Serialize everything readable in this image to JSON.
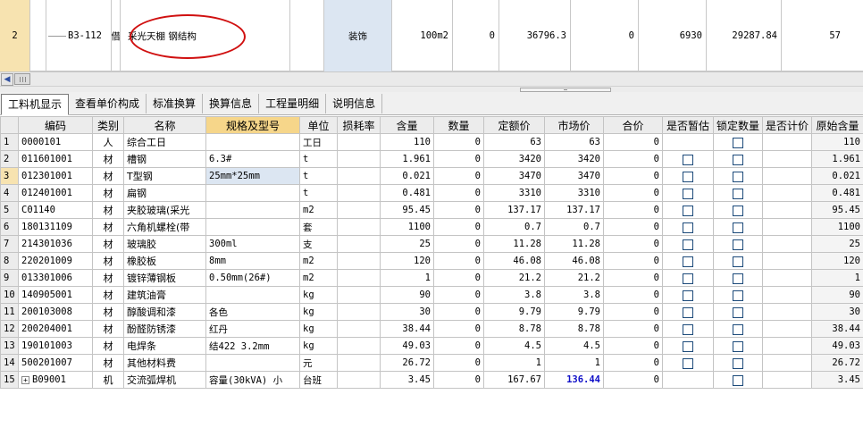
{
  "quota_row": {
    "row_no": "2",
    "code": "B3-112",
    "type": "借",
    "name": "采光天棚 钢结构",
    "major": "装饰",
    "unit": "100m2",
    "quantity": "0",
    "price1": "36796.3",
    "price2": "0",
    "price3": "6930",
    "price4": "29287.84",
    "price5": "57"
  },
  "tabs": [
    {
      "label": "工料机显示",
      "active": true
    },
    {
      "label": "查看单价构成"
    },
    {
      "label": "标准换算"
    },
    {
      "label": "换算信息"
    },
    {
      "label": "工程量明细"
    },
    {
      "label": "说明信息"
    }
  ],
  "columns": [
    "编码",
    "类别",
    "名称",
    "规格及型号",
    "单位",
    "损耗率",
    "含量",
    "数量",
    "定额价",
    "市场价",
    "合价",
    "是否暂估",
    "锁定数量",
    "是否计价",
    "原始含量"
  ],
  "rows": [
    {
      "no": "1",
      "code": "0000101",
      "cat": "人",
      "name": "综合工日",
      "spec": "",
      "unit": "工日",
      "loss": "",
      "content": "110",
      "qty": "0",
      "base": "63",
      "market": "63",
      "total": "0",
      "est": false,
      "lock": true,
      "orig": "110"
    },
    {
      "no": "2",
      "code": "011601001",
      "cat": "材",
      "name": "槽钢",
      "spec": "6.3#",
      "unit": "t",
      "loss": "",
      "content": "1.961",
      "qty": "0",
      "base": "3420",
      "market": "3420",
      "total": "0",
      "est": true,
      "lock": true,
      "orig": "1.961"
    },
    {
      "no": "3",
      "code": "012301001",
      "cat": "材",
      "name": "T型钢",
      "spec": "25mm*25mm",
      "unit": "t",
      "loss": "",
      "content": "0.021",
      "qty": "0",
      "base": "3470",
      "market": "3470",
      "total": "0",
      "est": true,
      "lock": true,
      "orig": "0.021"
    },
    {
      "no": "4",
      "code": "012401001",
      "cat": "材",
      "name": "扁钢",
      "spec": "",
      "unit": "t",
      "loss": "",
      "content": "0.481",
      "qty": "0",
      "base": "3310",
      "market": "3310",
      "total": "0",
      "est": true,
      "lock": true,
      "orig": "0.481"
    },
    {
      "no": "5",
      "code": "C01140",
      "cat": "材",
      "name": "夹胶玻璃(采光",
      "spec": "",
      "unit": "m2",
      "loss": "",
      "content": "95.45",
      "qty": "0",
      "base": "137.17",
      "market": "137.17",
      "total": "0",
      "est": true,
      "lock": true,
      "orig": "95.45"
    },
    {
      "no": "6",
      "code": "180131109",
      "cat": "材",
      "name": "六角机螺栓(带",
      "spec": "",
      "unit": "套",
      "loss": "",
      "content": "1100",
      "qty": "0",
      "base": "0.7",
      "market": "0.7",
      "total": "0",
      "est": true,
      "lock": true,
      "orig": "1100"
    },
    {
      "no": "7",
      "code": "214301036",
      "cat": "材",
      "name": "玻璃胶",
      "spec": "300ml",
      "unit": "支",
      "loss": "",
      "content": "25",
      "qty": "0",
      "base": "11.28",
      "market": "11.28",
      "total": "0",
      "est": true,
      "lock": true,
      "orig": "25"
    },
    {
      "no": "8",
      "code": "220201009",
      "cat": "材",
      "name": "橡胶板",
      "spec": "8mm",
      "unit": "m2",
      "loss": "",
      "content": "120",
      "qty": "0",
      "base": "46.08",
      "market": "46.08",
      "total": "0",
      "est": true,
      "lock": true,
      "orig": "120"
    },
    {
      "no": "9",
      "code": "013301006",
      "cat": "材",
      "name": "镀锌薄钢板",
      "spec": "0.50mm(26#)",
      "unit": "m2",
      "loss": "",
      "content": "1",
      "qty": "0",
      "base": "21.2",
      "market": "21.2",
      "total": "0",
      "est": true,
      "lock": true,
      "orig": "1"
    },
    {
      "no": "10",
      "code": "140905001",
      "cat": "材",
      "name": "建筑油膏",
      "spec": "",
      "unit": "kg",
      "loss": "",
      "content": "90",
      "qty": "0",
      "base": "3.8",
      "market": "3.8",
      "total": "0",
      "est": true,
      "lock": true,
      "orig": "90"
    },
    {
      "no": "11",
      "code": "200103008",
      "cat": "材",
      "name": "醇酸调和漆",
      "spec": "各色",
      "unit": "kg",
      "loss": "",
      "content": "30",
      "qty": "0",
      "base": "9.79",
      "market": "9.79",
      "total": "0",
      "est": true,
      "lock": true,
      "orig": "30"
    },
    {
      "no": "12",
      "code": "200204001",
      "cat": "材",
      "name": "酚醛防锈漆",
      "spec": "红丹",
      "unit": "kg",
      "loss": "",
      "content": "38.44",
      "qty": "0",
      "base": "8.78",
      "market": "8.78",
      "total": "0",
      "est": true,
      "lock": true,
      "orig": "38.44"
    },
    {
      "no": "13",
      "code": "190101003",
      "cat": "材",
      "name": "电焊条",
      "spec": "结422 3.2mm",
      "unit": "kg",
      "loss": "",
      "content": "49.03",
      "qty": "0",
      "base": "4.5",
      "market": "4.5",
      "total": "0",
      "est": true,
      "lock": true,
      "orig": "49.03"
    },
    {
      "no": "14",
      "code": "500201007",
      "cat": "材",
      "name": "其他材料费",
      "spec": "",
      "unit": "元",
      "loss": "",
      "content": "26.72",
      "qty": "0",
      "base": "1",
      "market": "1",
      "total": "0",
      "est": true,
      "lock": true,
      "orig": "26.72"
    },
    {
      "no": "15",
      "code": "B09001",
      "cat": "机",
      "name": "交流弧焊机",
      "spec": "容量(30kVA) 小",
      "unit": "台班",
      "loss": "",
      "content": "3.45",
      "qty": "0",
      "base": "167.67",
      "market": "136.44",
      "total": "0",
      "est": false,
      "lock": true,
      "orig": "3.45",
      "expandable": true,
      "market_highlight": true
    }
  ],
  "colors": {
    "row_header_selected": "#f7e3b0",
    "spec_header_highlight": "#f6d68a",
    "selected_cell": "#dce6f2",
    "market_changed": "#1010c8",
    "annotation_circle": "#d01010"
  }
}
